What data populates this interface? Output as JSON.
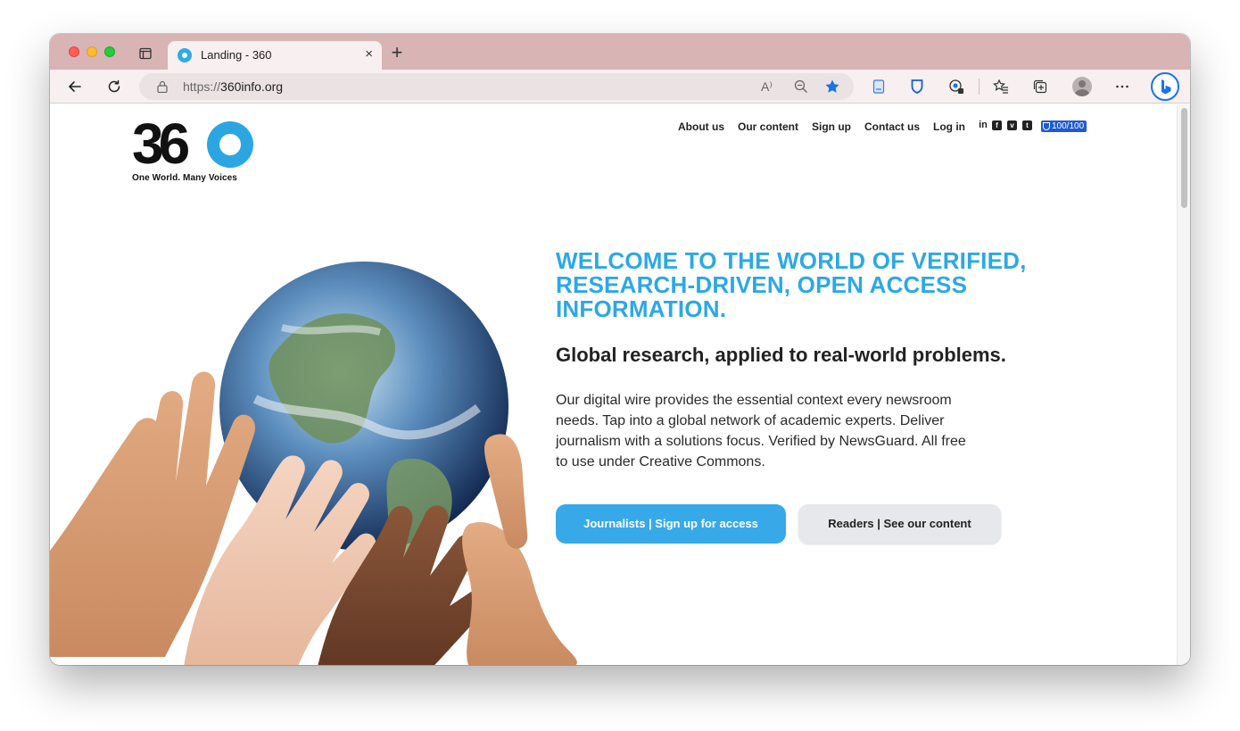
{
  "browser": {
    "tab_title": "Landing - 360",
    "tab_close": "×",
    "new_tab": "+",
    "url_prefix": "https://",
    "url_host": "360info.org",
    "read_aloud_icon": "A⁾",
    "favorite_active": true,
    "accent_color": "#1a73e8",
    "tabstrip_color": "#d8b4b5"
  },
  "site": {
    "logo": {
      "mark": "36",
      "tagline": "One World. Many Voices"
    },
    "nav": [
      {
        "label": "About us"
      },
      {
        "label": "Our content"
      },
      {
        "label": "Sign up"
      },
      {
        "label": "Contact us"
      },
      {
        "label": "Log in"
      }
    ],
    "social": [
      {
        "icon": "linkedin-icon",
        "glyph": "in"
      },
      {
        "icon": "facebook-icon",
        "glyph": "f"
      },
      {
        "icon": "vimeo-icon",
        "glyph": "v"
      },
      {
        "icon": "twitter-icon",
        "glyph": "t"
      }
    ],
    "newsguard_score": "100/100",
    "brand_color": "#2ca8e6"
  },
  "hero": {
    "headline": "WELCOME TO THE WORLD OF VERIFIED, RESEARCH-DRIVEN, OPEN ACCESS INFORMATION.",
    "subhead": "Global research, applied to real-world problems.",
    "body": "Our digital wire provides the essential context every newsroom needs. Tap into a global network of academic experts. Deliver journalism with a solutions focus. Verified by NewsGuard. All free to use under Creative Commons.",
    "primary_cta": "Journalists | Sign up for access",
    "secondary_cta": "Readers | See our content",
    "image": "hands-holding-earth-globe"
  }
}
